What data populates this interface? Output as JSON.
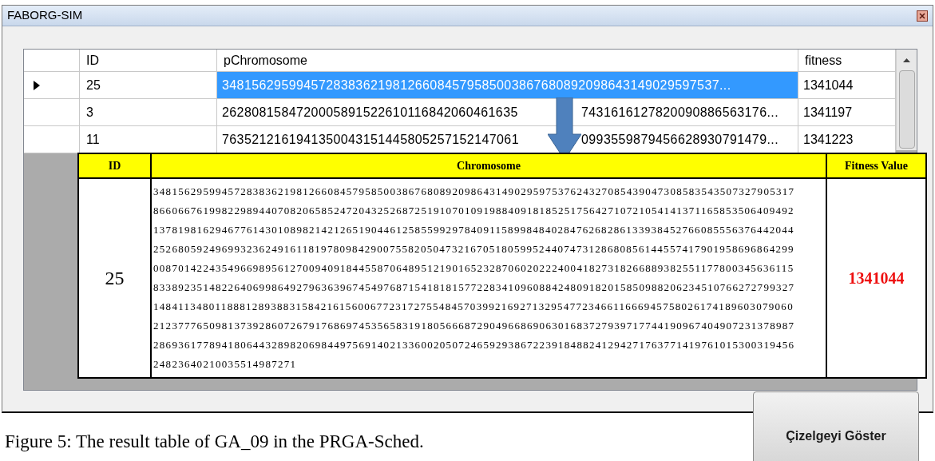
{
  "window": {
    "title": "FABORG-SIM"
  },
  "grid": {
    "columns": [
      "ID",
      "pChromosome",
      "fitness"
    ],
    "rows": [
      {
        "selected": true,
        "id": "25",
        "pchromosome": [
          "3481562959945728383621981266084579585003867680892098643149029597537..."
        ],
        "fitness": "1341044"
      },
      {
        "selected": false,
        "id": "3",
        "pchromosome": [
          "2628081584720005891522610116842060461635",
          "7431616127820090886563176..."
        ],
        "fitness": "1341197"
      },
      {
        "selected": false,
        "id": "11",
        "pchromosome": [
          "7635212161941350043151445805257152147061",
          "0993559879456628930791479..."
        ],
        "fitness": "1341223"
      }
    ]
  },
  "detail_table": {
    "columns": [
      "ID",
      "Chromosome",
      "Fitness Value"
    ],
    "id": "25",
    "fitness": "1341044",
    "chromosome_lines": [
      "3481562959945728383621981266084579585003867680892098643149029597537624327085439047308583543507327905317",
      "8660667619982298944070820658524720432526872519107010919884091818525175642710721054141371165853506409492",
      "1378198162946776143010898214212651904461258559929784091158998484028476268286133938452766085556376442044",
      "2526805924969932362491611819780984290075582050473216705180599524407473128680856144557417901958696864299",
      "0087014224354966989561270094091844558706489512190165232870602022240041827318266889382551177800345636115",
      "8338923514822640699864927963639674549768715418181577228341096088424809182015850988206234510766272799327",
      "1484113480118881289388315842161560067723172755484570399216927132954772346611666945758026174189603079060",
      "2123777650981373928607267917686974535658319180566687290496686906301683727939717744190967404907231378987",
      "2869361778941806443289820698449756914021336002050724659293867223918488241294271763771419761015300319456",
      "24823640210035514987271"
    ]
  },
  "button": {
    "label": "Çizelgeyi Göster"
  },
  "caption": "Figure 5: The result table of GA_09 in the PRGA-Sched."
}
